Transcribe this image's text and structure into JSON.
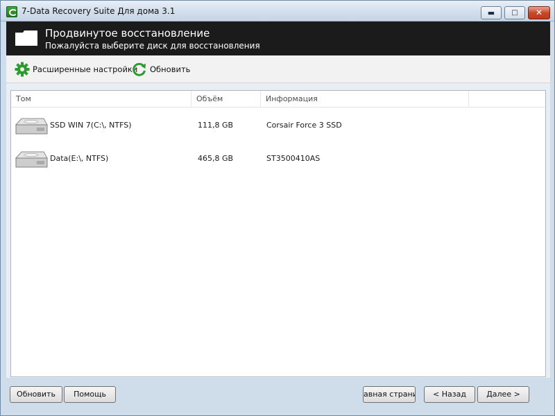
{
  "window": {
    "title": "7-Data Recovery Suite Для дома 3.1",
    "controls": {
      "minimize": "▬",
      "maximize": "□",
      "close": "✕"
    }
  },
  "header": {
    "title": "Продвинутое восстановление",
    "subtitle": "Пожалуйста выберите диск для восстановления",
    "icon": "folder-icon"
  },
  "toolbar": {
    "advanced_settings": {
      "label": "Расширенные настройки",
      "icon": "gear-icon"
    },
    "refresh": {
      "label": "Обновить",
      "icon": "refresh-icon"
    }
  },
  "table": {
    "columns": [
      "Том",
      "Объём",
      "Информация"
    ],
    "rows": [
      {
        "volume": "SSD WIN 7(C:\\, NTFS)",
        "size": "111,8 GB",
        "info": "Corsair Force 3 SSD",
        "icon": "hard-drive-icon"
      },
      {
        "volume": "Data(E:\\, NTFS)",
        "size": "465,8 GB",
        "info": "ST3500410AS",
        "icon": "hard-drive-icon"
      }
    ]
  },
  "buttons": {
    "refresh": "Обновить",
    "help": "Помощь",
    "home": "авная страни",
    "back": "< Назад",
    "next": "Далее >"
  },
  "colors": {
    "accent_green": "#2e9a2e",
    "header_bg": "#1b1b1b",
    "titlebar": "#d2deec"
  }
}
